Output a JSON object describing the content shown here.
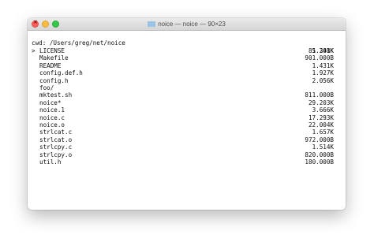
{
  "window": {
    "title": "noice — noice — 90×23",
    "icon": "folder-icon"
  },
  "header": {
    "cwd": "cwd: /Users/greg/net/noice",
    "total": "85.248K"
  },
  "cursor": ">",
  "entries": [
    {
      "name": "LICENSE",
      "size": "1.301K",
      "selected": true
    },
    {
      "name": "Makefile",
      "size": "901.000B"
    },
    {
      "name": "README",
      "size": "1.431K"
    },
    {
      "name": "config.def.h",
      "size": "1.927K"
    },
    {
      "name": "config.h",
      "size": "2.056K"
    },
    {
      "name": "foo/",
      "size": ""
    },
    {
      "name": "mktest.sh",
      "size": "811.000B"
    },
    {
      "name": "noice*",
      "size": "29.203K"
    },
    {
      "name": "noice.1",
      "size": "3.666K"
    },
    {
      "name": "noice.c",
      "size": "17.293K"
    },
    {
      "name": "noice.o",
      "size": "22.004K"
    },
    {
      "name": "strlcat.c",
      "size": "1.657K"
    },
    {
      "name": "strlcat.o",
      "size": "972.000B"
    },
    {
      "name": "strlcpy.c",
      "size": "1.514K"
    },
    {
      "name": "strlcpy.o",
      "size": "820.000B"
    },
    {
      "name": "util.h",
      "size": "180.000B"
    }
  ]
}
